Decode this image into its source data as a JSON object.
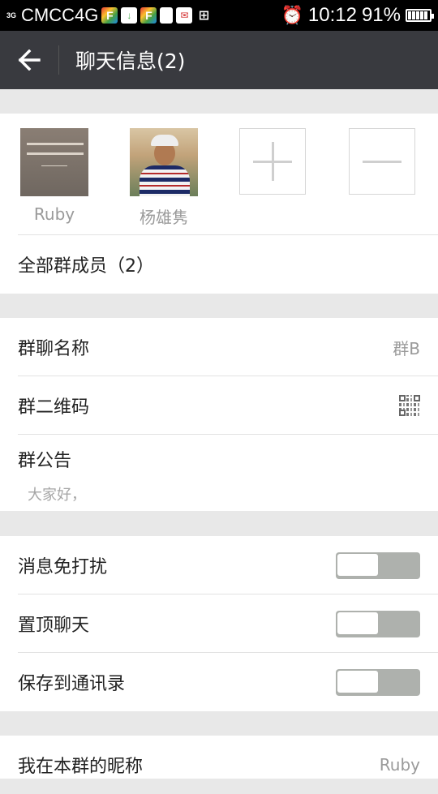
{
  "status_bar": {
    "network": "3G",
    "carrier": "CMCC4G",
    "time": "10:12",
    "battery_percent": "91%",
    "battery_level": 0.91,
    "icons": [
      "flipboard-icon",
      "download-icon",
      "flipboard-icon",
      "document-icon",
      "mail-icon",
      "tray-icon",
      "alarm-icon",
      "battery-icon"
    ]
  },
  "header": {
    "title": "聊天信息(2)",
    "back_icon": "back-arrow-icon"
  },
  "members": {
    "items": [
      {
        "name": "Ruby",
        "avatar": "book-cover-image"
      },
      {
        "name": "杨雄隽",
        "avatar": "person-photo"
      }
    ],
    "add_icon": "plus-icon",
    "remove_icon": "minus-icon",
    "all_members_label": "全部群成员（2）"
  },
  "group_info": {
    "name_label": "群聊名称",
    "name_value": "群B",
    "qr_label": "群二维码",
    "qr_icon": "qr-code-icon",
    "notice_label": "群公告",
    "notice_text": "大家好，"
  },
  "settings": {
    "mute_label": "消息免打扰",
    "mute_on": false,
    "pin_label": "置顶聊天",
    "pin_on": false,
    "save_label": "保存到通讯录",
    "save_on": false
  },
  "nickname": {
    "label": "我在本群的昵称",
    "value": "Ruby"
  },
  "colors": {
    "header_bg": "#393a3f",
    "page_bg": "#e8e8e8",
    "toggle_off": "#aeb1ad"
  }
}
